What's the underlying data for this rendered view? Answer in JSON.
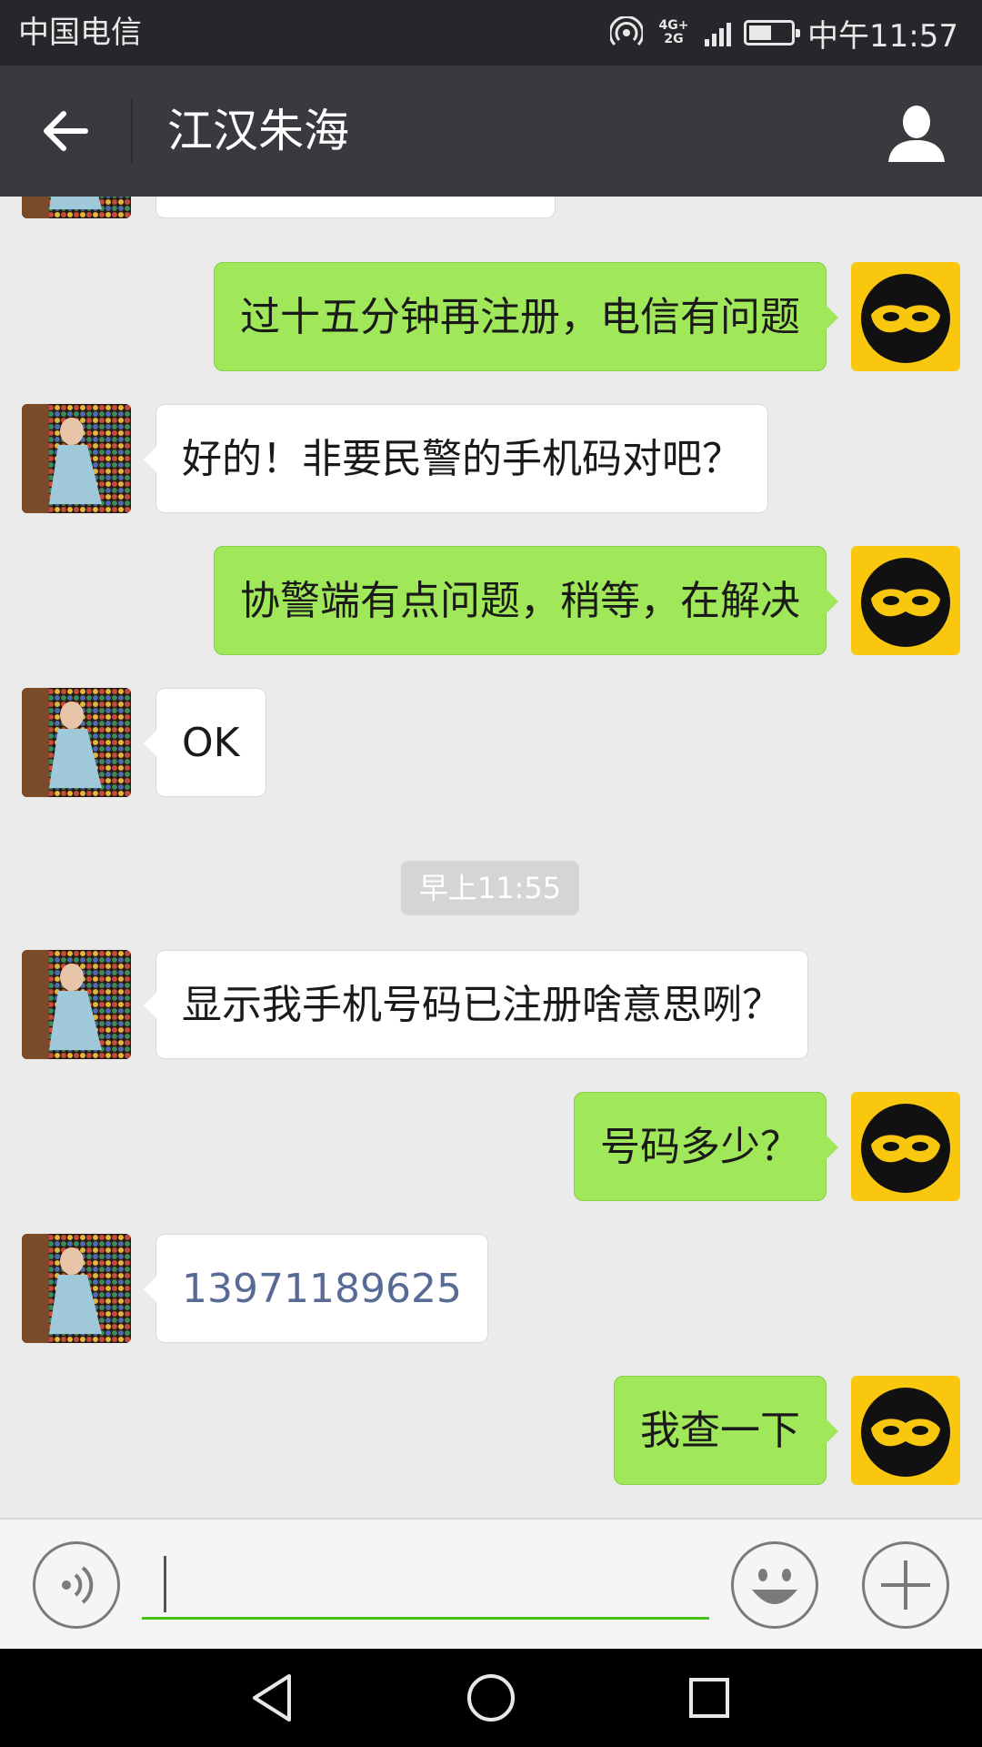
{
  "status_bar": {
    "carrier": "中国电信",
    "network_top": "4G+",
    "network_bottom": "2G",
    "time": "中午11:57",
    "battery_level": 0.55
  },
  "header": {
    "title": "江汉朱海",
    "back_icon": "arrow-left-icon",
    "profile_icon": "person-icon"
  },
  "messages": [
    {
      "side": "in",
      "text": ""
    },
    {
      "side": "out",
      "text": "过十五分钟再注册，电信有问题"
    },
    {
      "side": "in",
      "text": "好的！非要民警的手机码对吧？"
    },
    {
      "side": "out",
      "text": "协警端有点问题，稍等，在解决"
    },
    {
      "side": "in",
      "text": "OK"
    },
    {
      "side": "time",
      "text": "早上11:55"
    },
    {
      "side": "in",
      "text": "显示我手机号码已注册啥意思咧？"
    },
    {
      "side": "out",
      "text": "号码多少？"
    },
    {
      "side": "in",
      "text": "13971189625"
    },
    {
      "side": "out",
      "text": "我查一下"
    }
  ],
  "input_bar": {
    "voice_icon": "voice-icon",
    "emoji_icon": "smiley-icon",
    "plus_icon": "plus-icon",
    "input_value": ""
  },
  "nav_bar": {
    "back_icon": "triangle-back-icon",
    "home_icon": "circle-home-icon",
    "recents_icon": "square-recents-icon"
  },
  "colors": {
    "status_bg": "#26272b",
    "title_bg": "#393a3f",
    "chat_bg": "#ebebeb",
    "outgoing_bubble": "#a0e75a",
    "incoming_bubble": "#ffffff",
    "link_text": "#576b95",
    "input_underline": "#45c01a",
    "self_avatar": "#f9c80e"
  }
}
